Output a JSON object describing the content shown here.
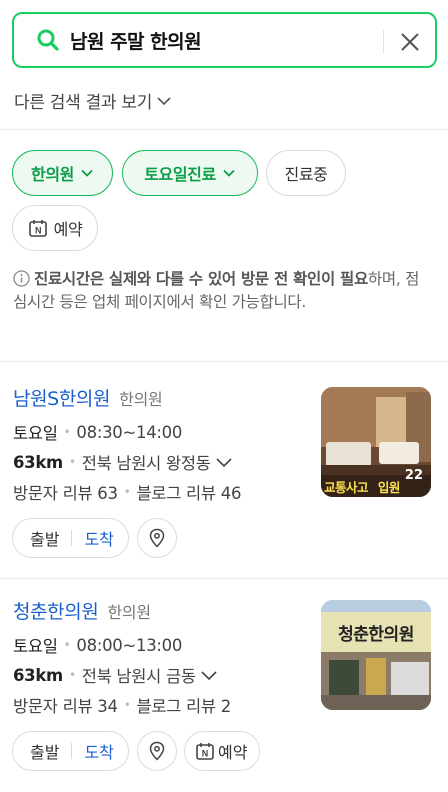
{
  "search": {
    "query": "남원 주말 한의원"
  },
  "other_results_label": "다른 검색 결과 보기",
  "filters": [
    {
      "label": "한의원",
      "active": true,
      "dropdown": true
    },
    {
      "label": "토요일진료",
      "active": true,
      "dropdown": true
    },
    {
      "label": "진료중",
      "active": false,
      "dropdown": false
    },
    {
      "label": "예약",
      "active": false,
      "dropdown": false,
      "icon": "naver-booking-icon"
    }
  ],
  "notice": {
    "bold": "진료시간은 실제와 다를 수 있어 방문 전 확인이 필요",
    "rest": "하며, 점심시간 등은 업체 페이지에서 확인 가능합니다."
  },
  "places": [
    {
      "name": "남원S한의원",
      "category": "한의원",
      "day": "토요일",
      "hours": "08:30~14:00",
      "distance": "63km",
      "address": "전북 남원시 왕정동",
      "visitor_reviews": "방문자 리뷰 63",
      "blog_reviews": "블로그 리뷰 46",
      "photo_count": "22",
      "photo_caption_1": "교통사고",
      "photo_caption_2": "입원",
      "depart_label": "출발",
      "arrive_label": "도착",
      "has_reservation": false
    },
    {
      "name": "청춘한의원",
      "category": "한의원",
      "day": "토요일",
      "hours": "08:00~13:00",
      "distance": "63km",
      "address": "전북 남원시 금동",
      "visitor_reviews": "방문자 리뷰 34",
      "blog_reviews": "블로그 리뷰 2",
      "photo_sign": "청춘한의원",
      "depart_label": "출발",
      "arrive_label": "도착",
      "reservation_label": "예약",
      "has_reservation": true
    }
  ],
  "colors": {
    "accent_green": "#19ce60",
    "link_blue": "#1a5fd1",
    "chip_green_text": "#0b9e48"
  }
}
